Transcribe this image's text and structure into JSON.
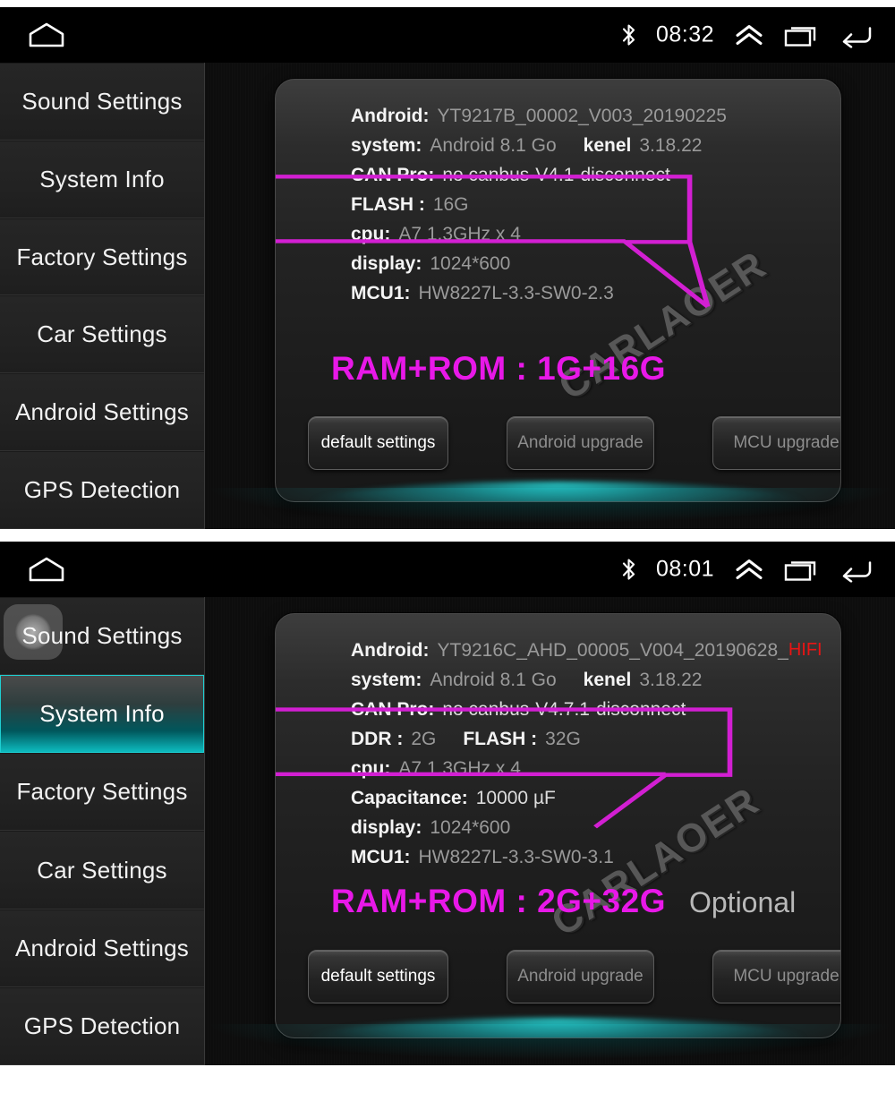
{
  "meta": {
    "accent_magenta": "#E818E8",
    "accent_teal": "#0DBCC0",
    "hifi_red": "#E81414",
    "watermark": "CARLAOER"
  },
  "panels": [
    {
      "statusbar": {
        "home_icon": "home-icon",
        "bluetooth_icon": "bluetooth-icon",
        "clock": "08:32",
        "chevron_up_icon": "chevron-up-icon",
        "recents_icon": "recents-icon",
        "back_icon": "back-icon"
      },
      "sidebar": {
        "items": [
          {
            "label": "Sound Settings",
            "selected": false
          },
          {
            "label": "System Info",
            "selected": false
          },
          {
            "label": "Factory Settings",
            "selected": false
          },
          {
            "label": "Car Settings",
            "selected": false
          },
          {
            "label": "Android Settings",
            "selected": false
          },
          {
            "label": "GPS Detection",
            "selected": false
          }
        ],
        "touch_feedback": false
      },
      "info": [
        {
          "label": "Android:",
          "value": "YT9217B_00002_V003_20190225",
          "bright": false
        },
        {
          "label": "system:",
          "value": "Android 8.1 Go",
          "label2": "kenel",
          "value2": "3.18.22",
          "bright": false
        },
        {
          "label": "CAN Pro:",
          "value": "no canbus-V4.1-disconnect",
          "bright": true
        },
        {
          "label": "FLASH :",
          "value": "16G",
          "bright": false,
          "highlighted": true
        },
        {
          "label": "cpu:",
          "value": "A7 1.3GHz x 4",
          "bright": false,
          "highlighted": true
        },
        {
          "label": "display:",
          "value": "1024*600",
          "bright": false
        },
        {
          "label": "MCU1:",
          "value": "HW8227L-3.3-SW0-2.3",
          "bright": false
        }
      ],
      "watermark": "CARLAOER",
      "headline": {
        "text": "RAM+ROM : 1G+16G",
        "optional": ""
      },
      "buttons": [
        {
          "label": "default settings",
          "enabled": true
        },
        {
          "label": "Android upgrade",
          "enabled": false
        },
        {
          "label": "MCU upgrade",
          "enabled": false
        }
      ]
    },
    {
      "statusbar": {
        "home_icon": "home-icon",
        "bluetooth_icon": "bluetooth-icon",
        "clock": "08:01",
        "chevron_up_icon": "chevron-up-icon",
        "recents_icon": "recents-icon",
        "back_icon": "back-icon"
      },
      "sidebar": {
        "items": [
          {
            "label": "Sound Settings",
            "selected": false
          },
          {
            "label": "System Info",
            "selected": true
          },
          {
            "label": "Factory Settings",
            "selected": false
          },
          {
            "label": "Car Settings",
            "selected": false
          },
          {
            "label": "Android Settings",
            "selected": false
          },
          {
            "label": "GPS Detection",
            "selected": false
          }
        ],
        "touch_feedback": true
      },
      "info": [
        {
          "label": "Android:",
          "value": "YT9216C_AHD_00005_V004_20190628_",
          "suffix": "HIFI",
          "bright": false
        },
        {
          "label": "system:",
          "value": "Android 8.1 Go",
          "label2": "kenel",
          "value2": "3.18.22",
          "bright": false
        },
        {
          "label": "CAN Pro:",
          "value": "no canbus-V4.7.1-disconnect",
          "bright": true
        },
        {
          "label": "DDR :",
          "value": "2G",
          "label2": "FLASH :",
          "value2": "32G",
          "bright": false,
          "highlighted": true
        },
        {
          "label": "cpu:",
          "value": "A7 1.3GHz x 4",
          "bright": false,
          "highlighted": true
        },
        {
          "label": "Capacitance:",
          "value": "10000 µF",
          "bright": true
        },
        {
          "label": "display:",
          "value": "1024*600",
          "bright": false
        },
        {
          "label": "MCU1:",
          "value": "HW8227L-3.3-SW0-3.1",
          "bright": false
        }
      ],
      "watermark": "CARLAOER",
      "headline": {
        "text": "RAM+ROM : 2G+32G",
        "optional": "Optional"
      },
      "buttons": [
        {
          "label": "default settings",
          "enabled": true
        },
        {
          "label": "Android upgrade",
          "enabled": false
        },
        {
          "label": "MCU upgrade",
          "enabled": false
        }
      ]
    }
  ]
}
